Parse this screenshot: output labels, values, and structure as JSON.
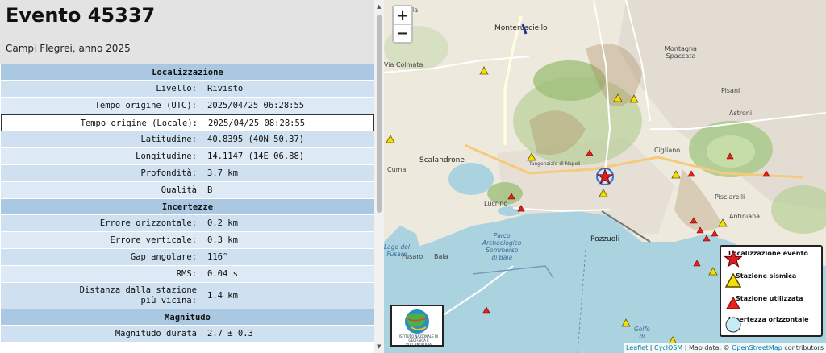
{
  "event": {
    "title": "Evento 45337",
    "subtitle": "Campi Flegrei, anno 2025"
  },
  "sections": {
    "localizzazione": "Localizzazione",
    "incertezze": "Incertezze",
    "magnitudo": "Magnitudo"
  },
  "fields": {
    "livello": {
      "label": "Livello:",
      "value": "Rivisto"
    },
    "tempo_utc": {
      "label": "Tempo origine (UTC):",
      "value": "2025/04/25 06:28:55"
    },
    "tempo_locale": {
      "label": "Tempo origine (Locale):",
      "value": "2025/04/25 08:28:55"
    },
    "latitudine": {
      "label": "Latitudine:",
      "value": "40.8395 (40N 50.37)"
    },
    "longitudine": {
      "label": "Longitudine:",
      "value": "14.1147 (14E 06.88)"
    },
    "profondita": {
      "label": "Profondità:",
      "value": "3.7 km"
    },
    "qualita": {
      "label": "Qualità",
      "value": "B"
    },
    "errore_orizzontale": {
      "label": "Errore orizzontale:",
      "value": "0.2 km"
    },
    "errore_verticale": {
      "label": "Errore verticale:",
      "value": "0.3 km"
    },
    "gap": {
      "label": "Gap angolare:",
      "value": "116°"
    },
    "rms": {
      "label": "RMS:",
      "value": "0.04 s"
    },
    "distanza": {
      "label_line1": "Distanza dalla stazione",
      "label_line2": "più vicina:",
      "value": "1.4 km"
    },
    "magnitudo_durata": {
      "label": "Magnitudo durata",
      "value": "2.7 ± 0.3"
    }
  },
  "map": {
    "zoom_in": "+",
    "zoom_out": "−",
    "places": {
      "monterusciello": "Monterusciello",
      "montagna_spaccata": "Montagna\nSpaccata",
      "montagna_line1": "Montagna",
      "montagna_line2": "Spaccata",
      "pisani": "Pisani",
      "astroni": "Astroni",
      "cigliano": "Cigliano",
      "pisciarelli": "Pisciarelli",
      "antiniana": "Antiniana",
      "scalandrone": "Scalandrone",
      "cuma": "Cuma",
      "lucrino": "Lucrino",
      "pozzuoli": "Pozzuoli",
      "fusaro": "Fusaro",
      "baia": "Baia",
      "lago_fusaro": "Lago del\nFusaro",
      "lago_line1": "Lago del",
      "lago_line2": "Fusaro",
      "parco_line1": "Parco",
      "parco_line2": "Archeologico",
      "parco_line3": "Sommerso",
      "parco_line4": "di Baia",
      "golfo_line1": "Golfo",
      "golfo_line2": "di",
      "via_colmata": "Via Colmata",
      "pola": "pola",
      "tangenziale": "Tangenziale di Napoli"
    },
    "legend": {
      "evento": "Localizzazione evento",
      "sismica": "Stazione sismica",
      "utilizzata": "Stazione utilizzata",
      "incertezza": "Incertezza orizzontale"
    },
    "logo_text": "ISTITUTO NAZIONALE DI GEOFISICA E VULCANOLOGIA",
    "attribution": {
      "leaflet": "Leaflet",
      "sep1": " | ",
      "cyclosm": "CyclOSM",
      "mid": " | Map data: © ",
      "osm": "OpenStreetMap",
      "end": " contributors"
    },
    "colors": {
      "water": "#a7cde4",
      "star": "#d42020",
      "station_yellow": "#f4e000",
      "station_red": "#e8201a",
      "uncertainty": "#c8ecf6"
    }
  }
}
